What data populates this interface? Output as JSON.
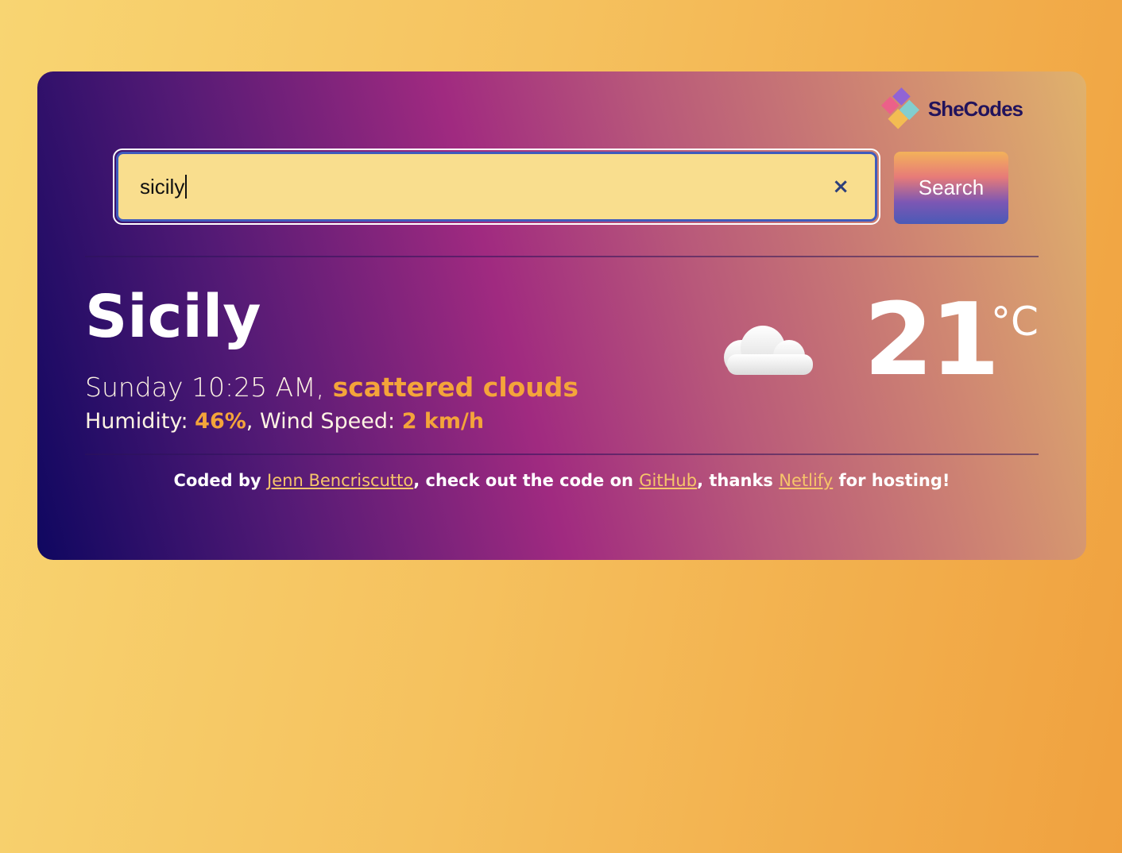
{
  "logo": {
    "text": "SheCodes"
  },
  "search": {
    "value": "sicily",
    "clear_icon": "×",
    "button_label": "Search"
  },
  "weather": {
    "city": "Sicily",
    "day_time": "Sunday 10:25 AM,",
    "description": "scattered clouds",
    "humidity_label": "Humidity:",
    "humidity_value": "46%",
    "wind_label": ", Wind Speed:",
    "wind_value": "2 km/h",
    "icon": "cloud-icon",
    "temperature": "21",
    "unit": "°C"
  },
  "footer": {
    "prefix": "Coded by",
    "author_link": "Jenn Bencriscutto",
    "middle": ", check out the code on",
    "github_link": "GitHub",
    "thanks": ", thanks",
    "netlify_link": "Netlify",
    "suffix": "for hosting!"
  },
  "colors": {
    "accent_orange": "#f4a43a",
    "link": "#f6c56a",
    "input_bg": "#f9de8e",
    "input_border": "#3f5bbd"
  }
}
